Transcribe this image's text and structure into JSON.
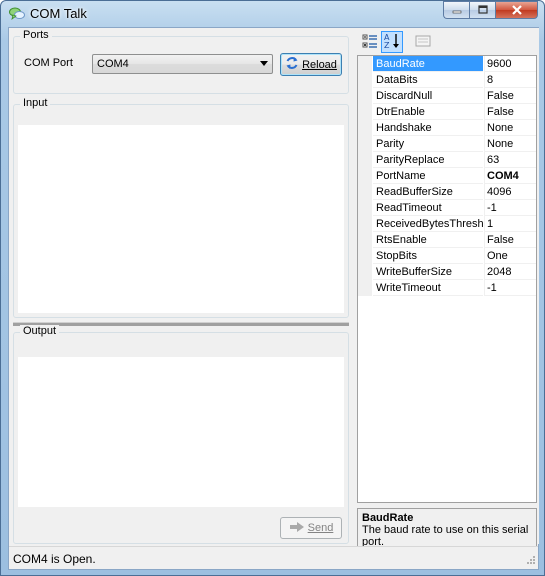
{
  "window": {
    "title": "COM Talk",
    "icon": "chat-bubbles-icon"
  },
  "ports": {
    "group_label": "Ports",
    "com_port_label": "COM Port",
    "selected_port": "COM4",
    "reload_label": "Reload"
  },
  "input": {
    "group_label": "Input",
    "value": ""
  },
  "output": {
    "group_label": "Output",
    "value": "",
    "send_label": "Send"
  },
  "property_grid": {
    "toolbar": [
      "categorized-icon",
      "alphabetical-icon",
      "property-pages-icon"
    ],
    "rows": [
      {
        "name": "BaudRate",
        "value": "9600"
      },
      {
        "name": "DataBits",
        "value": "8"
      },
      {
        "name": "DiscardNull",
        "value": "False"
      },
      {
        "name": "DtrEnable",
        "value": "False"
      },
      {
        "name": "Handshake",
        "value": "None"
      },
      {
        "name": "Parity",
        "value": "None"
      },
      {
        "name": "ParityReplace",
        "value": "63"
      },
      {
        "name": "PortName",
        "value": "COM4"
      },
      {
        "name": "ReadBufferSize",
        "value": "4096"
      },
      {
        "name": "ReadTimeout",
        "value": "-1"
      },
      {
        "name": "ReceivedBytesThreshold",
        "value": "1"
      },
      {
        "name": "RtsEnable",
        "value": "False"
      },
      {
        "name": "StopBits",
        "value": "One"
      },
      {
        "name": "WriteBufferSize",
        "value": "2048"
      },
      {
        "name": "WriteTimeout",
        "value": "-1"
      }
    ],
    "selected": "BaudRate",
    "bold_value": "PortName",
    "help_title": "BaudRate",
    "help_text": "The baud rate to use on this serial port."
  },
  "status": {
    "text": "COM4 is Open."
  },
  "colors": {
    "selection": "#3399ff",
    "titlebar": "#a9c9e6"
  }
}
